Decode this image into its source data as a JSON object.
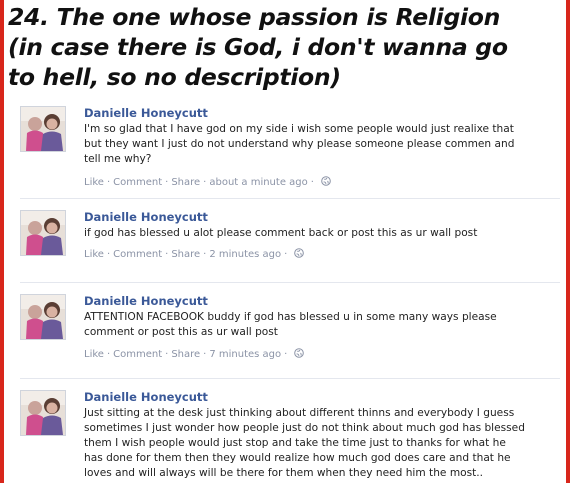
{
  "headline": {
    "line1": "24. The one whose passion is Religion",
    "line2": "(in case there is God, i don't wanna go",
    "line3": "to hell, so no description)"
  },
  "post_actions": {
    "like": "Like",
    "comment": "Comment",
    "share": "Share",
    "separator": "·"
  },
  "icons": {
    "globe": "globe-icon",
    "avatar": "profile-photo"
  },
  "colors": {
    "frame": "#d8261b",
    "author": "#3b5998",
    "meta": "#8b93a6"
  },
  "posts": [
    {
      "author": "Danielle Honeycutt",
      "lines": [
        "I'm so glad that I have god on my side i wish some people would just realixe that",
        "but they want I just do not understand why please someone please commen and",
        "tell me why?"
      ],
      "time": "about a minute ago"
    },
    {
      "author": "Danielle Honeycutt",
      "lines": [
        "if god has blessed u alot please comment back or post this as ur wall post"
      ],
      "time": "2 minutes ago"
    },
    {
      "author": "Danielle Honeycutt",
      "lines": [
        "ATTENTION FACEBOOK buddy if god has blessed u in some many ways please",
        "comment or post this as ur wall post"
      ],
      "time": "7 minutes ago"
    },
    {
      "author": "Danielle Honeycutt",
      "lines": [
        "Just sitting at the desk just thinking about different thinns and everybody I guess",
        "sometimes I just wonder how people just do not think about much god has blessed",
        "them I wish people would just stop and take the time just to thanks for what he",
        "has done for them then they would realize how much god does care and that he",
        "loves and will always will be there for them when they need him the most.."
      ],
      "time": ""
    }
  ]
}
